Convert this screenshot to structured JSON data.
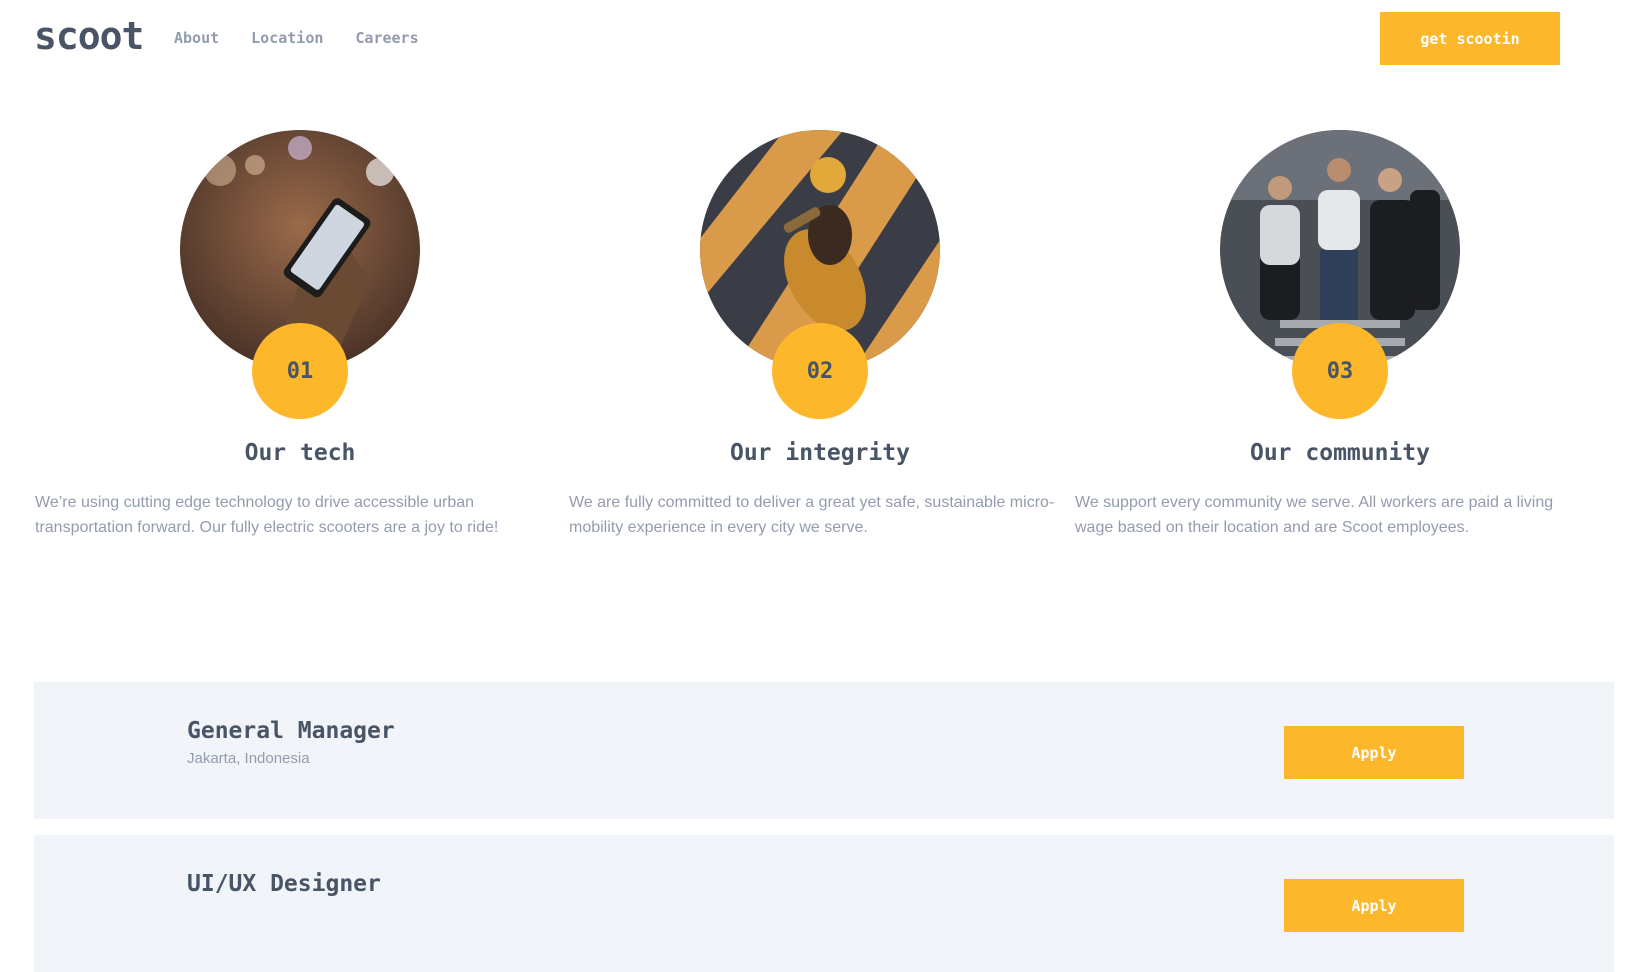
{
  "header": {
    "logo": "scoot",
    "nav": [
      "About",
      "Location",
      "Careers"
    ],
    "cta": "get scootin"
  },
  "features": [
    {
      "number": "01",
      "title": "Our tech",
      "body": "We’re using cutting edge technology to drive accessible urban transportation forward. Our fully electric scooters are a joy to ride!",
      "image": "phone-in-hand-photo"
    },
    {
      "number": "02",
      "title": "Our integrity",
      "body": "We are fully committed to deliver a great yet safe, sustainable micro-mobility experience in every city we serve.",
      "image": "scooter-rider-photo"
    },
    {
      "number": "03",
      "title": "Our community",
      "body": "We support every community we serve. All workers are paid a living wage based on their location and are Scoot employees.",
      "image": "pedestrians-crossing-photo"
    }
  ],
  "jobs": [
    {
      "title": "General Manager",
      "location": "Jakarta, Indonesia",
      "apply_label": "Apply"
    },
    {
      "title": "UI/UX Designer",
      "location": "",
      "apply_label": "Apply"
    }
  ],
  "colors": {
    "accent": "#fcb72b",
    "heading": "#495567",
    "muted": "#939cae",
    "panel": "#f1f4f8"
  }
}
